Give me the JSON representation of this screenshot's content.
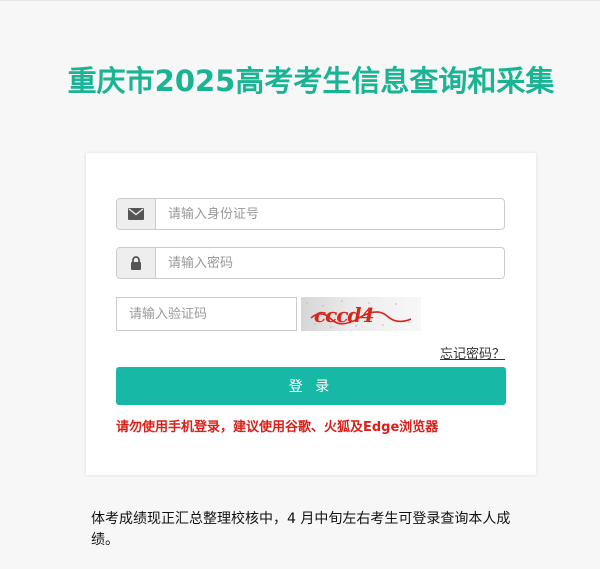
{
  "header": {
    "title": "重庆市2025高考考生信息查询和采集"
  },
  "login_form": {
    "id_field": {
      "icon": "envelope-icon",
      "placeholder": "请输入身份证号",
      "value": ""
    },
    "password_field": {
      "icon": "lock-icon",
      "placeholder": "请输入密码",
      "value": ""
    },
    "captcha_field": {
      "placeholder": "请输入验证码",
      "value": ""
    },
    "captcha_text": "cccd4",
    "forgot_password_label": "忘记密码？",
    "login_button_label": "登 录",
    "browser_warning": "请勿使用手机登录，建议使用谷歌、火狐及Edge浏览器"
  },
  "notice": {
    "text": "体考成绩现正汇总整理校核中，4 月中旬左右考生可登录查询本人成绩。"
  },
  "colors": {
    "brand": "#1ab394",
    "button": "#18b8a6",
    "warning": "#d9201b",
    "captcha_ink": "#d8261c"
  }
}
